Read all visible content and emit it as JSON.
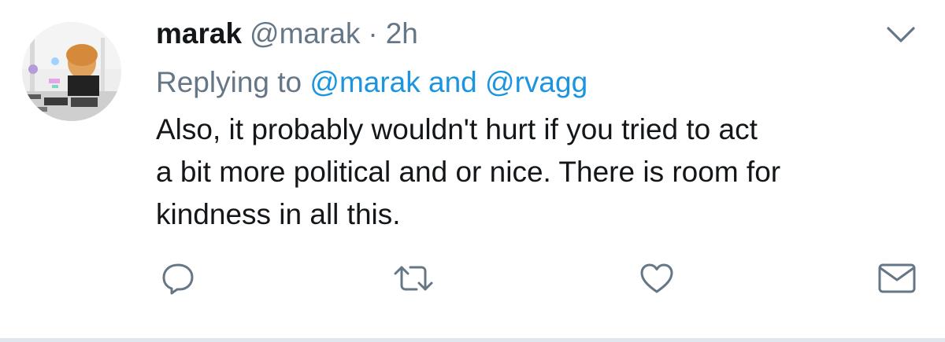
{
  "tweet": {
    "display_name": "marak",
    "handle": "@marak",
    "separator": "·",
    "time": "2h",
    "replying_prefix": "Replying to",
    "reply_mention_1": "@marak",
    "reply_conjunction": "and",
    "reply_mention_2": "@rvagg",
    "text_lines": [
      "Also, it probably wouldn't hurt if you tried to act",
      "a bit more political and or nice. There is room for",
      "kindness in all this."
    ]
  },
  "icons": {
    "menu": "chevron-down-icon",
    "reply": "speech-bubble-icon",
    "retweet": "retweet-icon",
    "like": "heart-icon",
    "dm": "envelope-icon"
  },
  "colors": {
    "text": "#14171a",
    "secondary": "#657786",
    "link": "#1b95e0",
    "icon": "#657786",
    "divider": "#e1e8ed"
  }
}
